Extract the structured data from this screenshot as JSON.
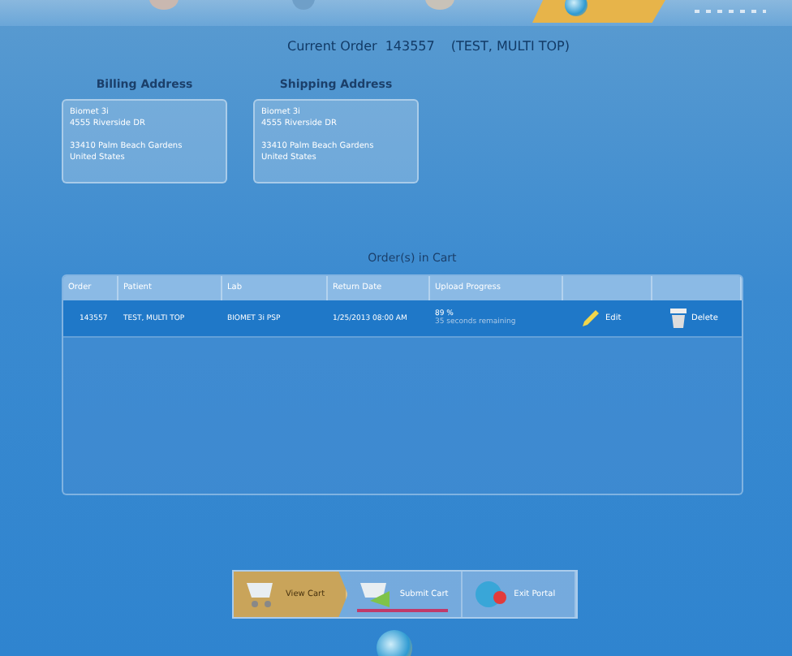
{
  "current_order": {
    "label": "Current Order",
    "number": "143557",
    "patient": "(TEST, MULTI TOP)"
  },
  "addresses": [
    {
      "title": "Billing Address",
      "blocks": [
        [
          "Biomet 3i",
          "4555 Riverside DR"
        ],
        [
          "33410 Palm Beach Gardens",
          "United States"
        ]
      ]
    },
    {
      "title": "Shipping Address",
      "blocks": [
        [
          "Biomet 3i",
          "4555 Riverside DR"
        ],
        [
          "33410 Palm Beach Gardens",
          "United States"
        ]
      ]
    }
  ],
  "cart": {
    "title": "Order(s) in Cart",
    "columns": [
      "Order",
      "Patient",
      "Lab",
      "Return Date",
      "Upload Progress"
    ],
    "rows": [
      {
        "order": "143557",
        "patient": "TEST, MULTI TOP",
        "lab": "BIOMET 3i PSP",
        "return_date": "1/25/2013 08:00 AM",
        "progress": "89 %",
        "remaining": "35 seconds remaining",
        "edit": "Edit",
        "delete": "Delete"
      }
    ]
  },
  "nav": [
    {
      "label": "View Cart",
      "kind": "cart",
      "selected": true
    },
    {
      "label": "Submit Cart",
      "kind": "submit",
      "selected": false
    },
    {
      "label": "Exit Portal",
      "kind": "exit",
      "selected": false
    }
  ]
}
